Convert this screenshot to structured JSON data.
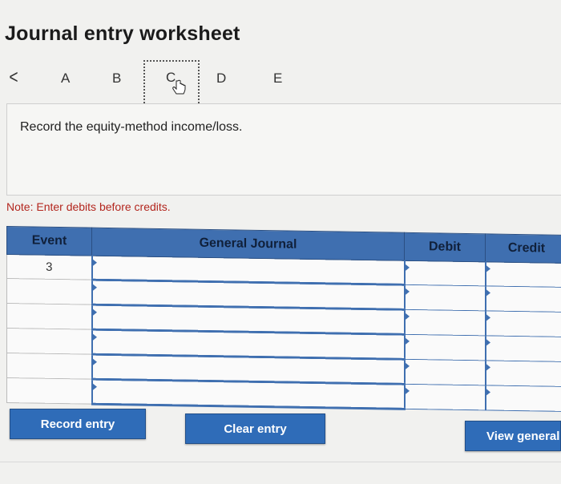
{
  "title": "Journal entry worksheet",
  "tabs": {
    "items": [
      "A",
      "B",
      "C",
      "D",
      "E"
    ],
    "active": "C"
  },
  "instruction": "Record the equity-method income/loss.",
  "note": "Note: Enter debits before credits.",
  "journal": {
    "headers": [
      "Event",
      "General Journal",
      "Debit",
      "Credit"
    ],
    "rows": [
      {
        "event": "3",
        "account": "",
        "debit": "",
        "credit": ""
      },
      {
        "event": "",
        "account": "",
        "debit": "",
        "credit": ""
      },
      {
        "event": "",
        "account": "",
        "debit": "",
        "credit": ""
      },
      {
        "event": "",
        "account": "",
        "debit": "",
        "credit": ""
      },
      {
        "event": "",
        "account": "",
        "debit": "",
        "credit": ""
      },
      {
        "event": "",
        "account": "",
        "debit": "",
        "credit": ""
      }
    ]
  },
  "buttons": {
    "record": "Record entry",
    "clear": "Clear entry",
    "view": "View general"
  },
  "colors": {
    "accent": "#2f6cb8",
    "header": "#3f6fb0",
    "note": "#b3261e"
  }
}
